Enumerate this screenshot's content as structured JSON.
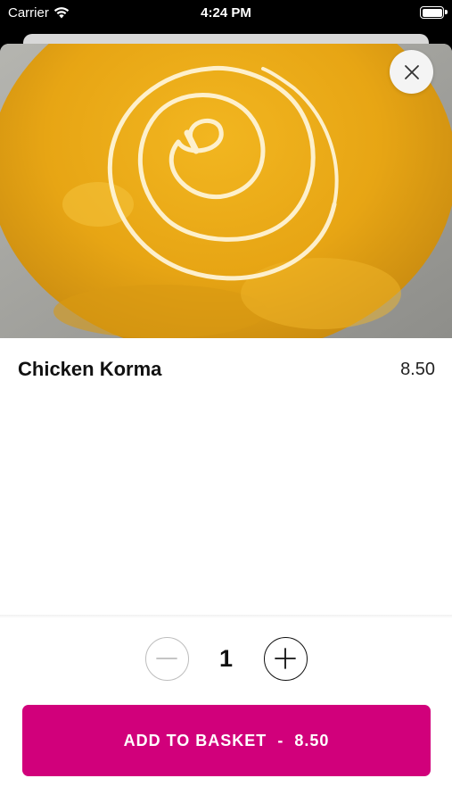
{
  "status_bar": {
    "carrier": "Carrier",
    "time": "4:24 PM"
  },
  "product": {
    "name": "Chicken Korma",
    "price": "8.50",
    "image_icon": "food-photo"
  },
  "quantity": {
    "value": "1"
  },
  "add_button": {
    "label": "ADD TO BASKET",
    "separator": "-",
    "total": "8.50"
  },
  "colors": {
    "accent": "#d1007b",
    "sauce": "#e8ab18"
  }
}
